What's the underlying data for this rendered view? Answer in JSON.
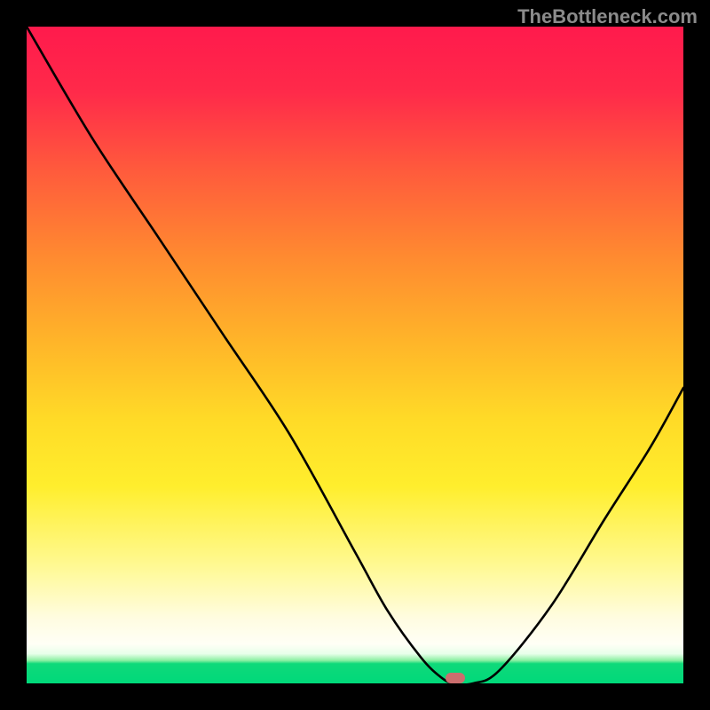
{
  "watermark": "TheBottleneck.com",
  "marker": {
    "x_frac": 0.653,
    "y_frac": 0.992
  },
  "chart_data": {
    "type": "line",
    "title": "",
    "xlabel": "",
    "ylabel": "",
    "ylim": [
      0,
      100
    ],
    "xlim": [
      0,
      100
    ],
    "x": [
      0,
      10,
      20,
      30,
      40,
      50,
      55,
      60,
      63,
      65,
      68,
      72,
      80,
      88,
      95,
      100
    ],
    "values": [
      100,
      83,
      68,
      53,
      38,
      20,
      11,
      4,
      1,
      0,
      0,
      2,
      12,
      25,
      36,
      45
    ]
  }
}
